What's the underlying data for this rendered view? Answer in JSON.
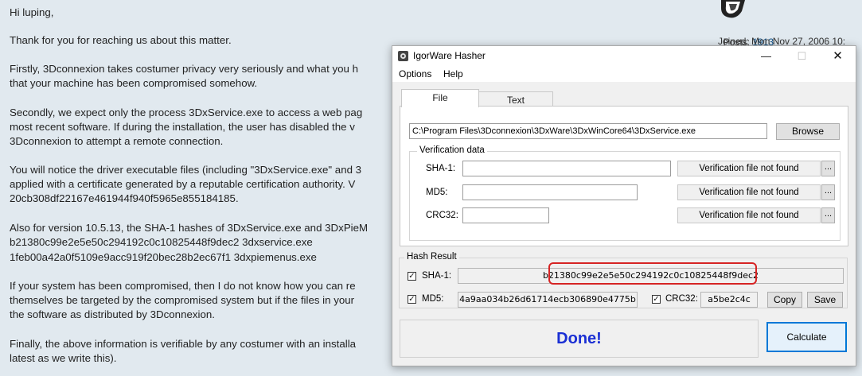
{
  "forum": {
    "lines": [
      "Hi luping,",
      "Thank for you for reaching us about this matter.",
      "Firstly, 3Dconnexion takes costumer privacy very seriously and what you h",
      "that your machine has been compromised somehow.",
      "Secondly, we expect only the process 3DxService.exe to access a web pag",
      "most recent software. If during the installation, the user has disabled the v",
      "3Dconnexion to attempt a remote connection.",
      "You will notice the driver executable files (including \"3DxService.exe\" and 3",
      "applied with a certificate generated by a reputable certification authority. V",
      "20cb308df22167e461944f940f5965e855184185.",
      "Also for version 10.5.13, the SHA-1 hashes of 3DxService.exe and 3DxPieM",
      "b21380c99e2e5e50c294192c0c10825448f9dec2 3dxservice.exe",
      "1feb00a42a0f5109e9acc919f20bec28b2ec67f1 3dxpiemenus.exe",
      "If your system has been compromised, then I do not know how you can re",
      "themselves be targeted by the compromised system but if the files in your",
      "the software as distributed by 3Dconnexion.",
      "Finally, the above information is verifiable by any costumer with an installa",
      "latest as we write this)."
    ],
    "side": {
      "posts_label": "Posts:",
      "posts_value": "1913",
      "joined": "Joined: Mon Nov 27, 2006 10:"
    }
  },
  "dialog": {
    "title": "IgorWare Hasher",
    "window_controls": {
      "minimize": "—",
      "maximize": "☐",
      "close": "✕"
    },
    "menu": [
      "Options",
      "Help"
    ],
    "tabs": [
      "File",
      "Text"
    ],
    "file_path": "C:\\Program Files\\3Dconnexion\\3DxWare\\3DxWinCore64\\3DxService.exe",
    "browse_label": "Browse",
    "verification": {
      "group_label": "Verification data",
      "rows": [
        {
          "label": "SHA-1:",
          "status": "Verification file not found",
          "dots": "..."
        },
        {
          "label": "MD5:",
          "status": "Verification file not found",
          "dots": "..."
        },
        {
          "label": "CRC32:",
          "status": "Verification file not found",
          "dots": "..."
        }
      ]
    },
    "hash_result": {
      "group_label": "Hash Result",
      "sha1_label": "SHA-1:",
      "sha1_value": "b21380c99e2e5e50c294192c0c10825448f9dec2",
      "md5_label": "MD5:",
      "md5_value": "4a9aa034b26d61714ecb306890e4775b",
      "crc32_label": "CRC32:",
      "crc32_value": "a5be2c4c",
      "copy_label": "Copy",
      "save_label": "Save",
      "check_mark": "✓"
    },
    "status_text": "Done!",
    "calculate_label": "Calculate",
    "accent_color": "#1a2fd4",
    "highlight_color": "#d62424"
  }
}
